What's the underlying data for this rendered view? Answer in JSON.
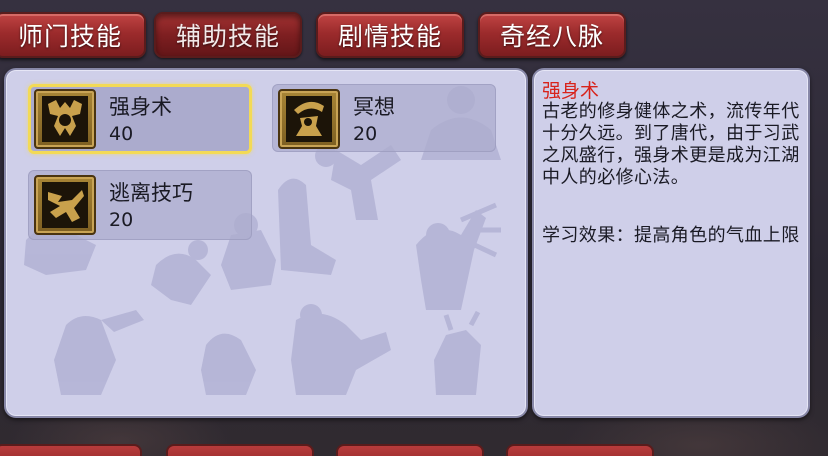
{
  "tabs": [
    {
      "label": "师门技能",
      "active": false
    },
    {
      "label": "辅助技能",
      "active": true
    },
    {
      "label": "剧情技能",
      "active": false
    },
    {
      "label": "奇经八脉",
      "active": false
    }
  ],
  "skills": [
    {
      "name": "强身术",
      "level": "40",
      "icon": "strength-skill-icon",
      "selected": true
    },
    {
      "name": "冥想",
      "level": "20",
      "icon": "meditation-skill-icon",
      "selected": false
    },
    {
      "name": "逃离技巧",
      "level": "20",
      "icon": "escape-skill-icon",
      "selected": false
    }
  ],
  "description": {
    "title": "强身术",
    "body": "古老的修身健体之术，流传年代十分久远。到了唐代，由于习武之风盛行，强身术更是成为江湖中人的必修心法。",
    "effect": "学习效果：提高角色的气血上限"
  },
  "colors": {
    "tab_red": "#9c2b2c",
    "panel_bg": "#cfcfe9",
    "selected_border": "#f3da55",
    "title_red": "#d8231b"
  }
}
